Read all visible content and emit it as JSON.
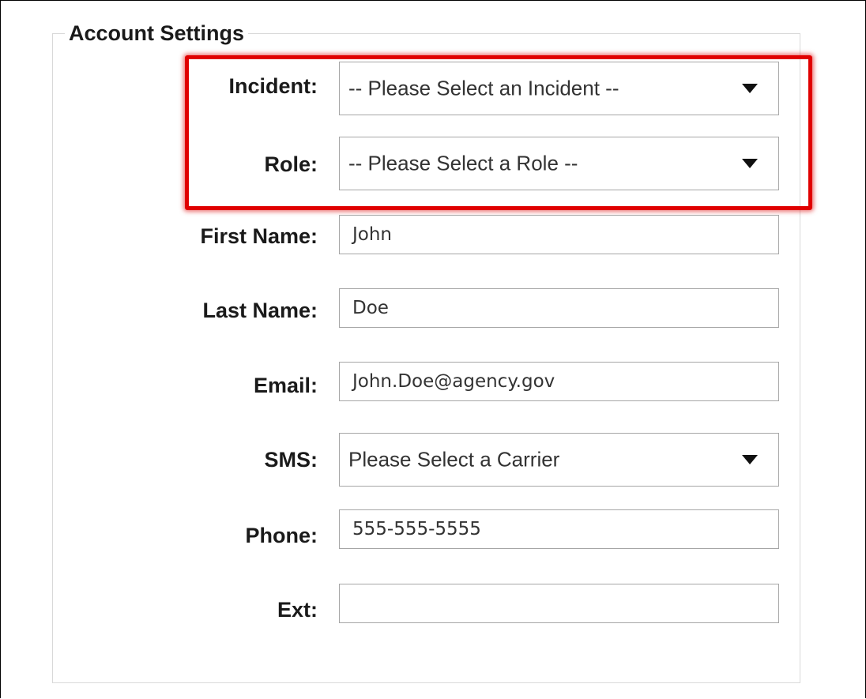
{
  "form": {
    "legend": "Account Settings",
    "incident": {
      "label": "Incident:",
      "selected": "-- Please Select an Incident --",
      "caret_icon": "chevron-down-icon"
    },
    "role": {
      "label": "Role:",
      "selected": "-- Please Select a Role --",
      "caret_icon": "chevron-down-icon"
    },
    "first_name": {
      "label": "First Name:",
      "value": "John"
    },
    "last_name": {
      "label": "Last Name:",
      "value": "Doe"
    },
    "email": {
      "label": "Email:",
      "value": "John.Doe@agency.gov"
    },
    "sms": {
      "label": "SMS:",
      "selected": "Please Select a Carrier",
      "caret_icon": "chevron-down-icon"
    },
    "phone": {
      "label": "Phone:",
      "value": "555-555-5555"
    },
    "ext": {
      "label": "Ext:",
      "value": ""
    }
  },
  "annotation": {
    "highlight_color": "#e00000"
  }
}
